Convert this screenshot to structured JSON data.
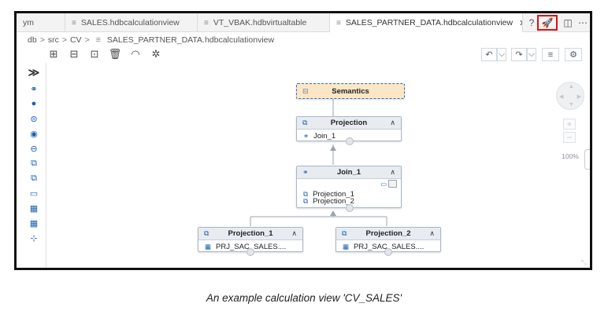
{
  "tabs": [
    {
      "label": "ym",
      "icon": "",
      "active": false,
      "closable": false
    },
    {
      "label": "SALES.hdbcalculationview",
      "icon": "≡",
      "active": false,
      "closable": false
    },
    {
      "label": "VT_VBAK.hdbvirtualtable",
      "icon": "≡",
      "active": false,
      "closable": false
    },
    {
      "label": "SALES_PARTNER_DATA.hdbcalculationview",
      "icon": "≡",
      "active": true,
      "closable": true,
      "close_label": "✕"
    }
  ],
  "tab_actions": {
    "help": "?",
    "deploy": "🚀",
    "split": "◫",
    "more": "⋯"
  },
  "breadcrumb": {
    "parts": [
      "db",
      ">",
      "src",
      ">",
      "CV",
      ">"
    ],
    "file_icon": "≡",
    "file": "SALES_PARTNER_DATA.hdbcalculationview"
  },
  "toolbar": {
    "left": [
      "⊞",
      "⊟",
      "⊡",
      "🗑",
      "◠",
      "✲"
    ],
    "undo": "↶",
    "undo_menu": "⌵",
    "redo": "↷",
    "redo_menu": "⌵",
    "columns": "≡",
    "settings": "⚙"
  },
  "palette": {
    "expand": "≫",
    "items": [
      "⚭",
      "●",
      "⊜",
      "◉",
      "⊖",
      "⧉",
      "⧉",
      "▭",
      "▦",
      "▦",
      "⊹"
    ]
  },
  "nodes": {
    "semantics": {
      "icon": "⊟",
      "title": "Semantics"
    },
    "projection": {
      "icon": "⧉",
      "title": "Projection",
      "caret": "∧",
      "rows": [
        {
          "icon": "⚭",
          "label": "Join_1"
        }
      ]
    },
    "join": {
      "icon": "⚭",
      "title": "Join_1",
      "caret": "∧",
      "badge": "▭",
      "rows": [
        {
          "icon": "⧉",
          "label": "Projection_1"
        },
        {
          "icon": "⧉",
          "label": "Projection_2"
        }
      ]
    },
    "projection1": {
      "icon": "⧉",
      "title": "Projection_1",
      "caret": "∧",
      "rows": [
        {
          "icon": "▦",
          "label": "PRJ_SAC_SALES...."
        }
      ]
    },
    "projection2": {
      "icon": "⧉",
      "title": "Projection_2",
      "caret": "∧",
      "rows": [
        {
          "icon": "▦",
          "label": "PRJ_SAC_SALES...."
        }
      ]
    }
  },
  "navigator": {
    "zoom_in": "+",
    "zoom_out": "−",
    "zoom_level": "100%"
  },
  "caption": "An example calculation view 'CV_SALES'"
}
